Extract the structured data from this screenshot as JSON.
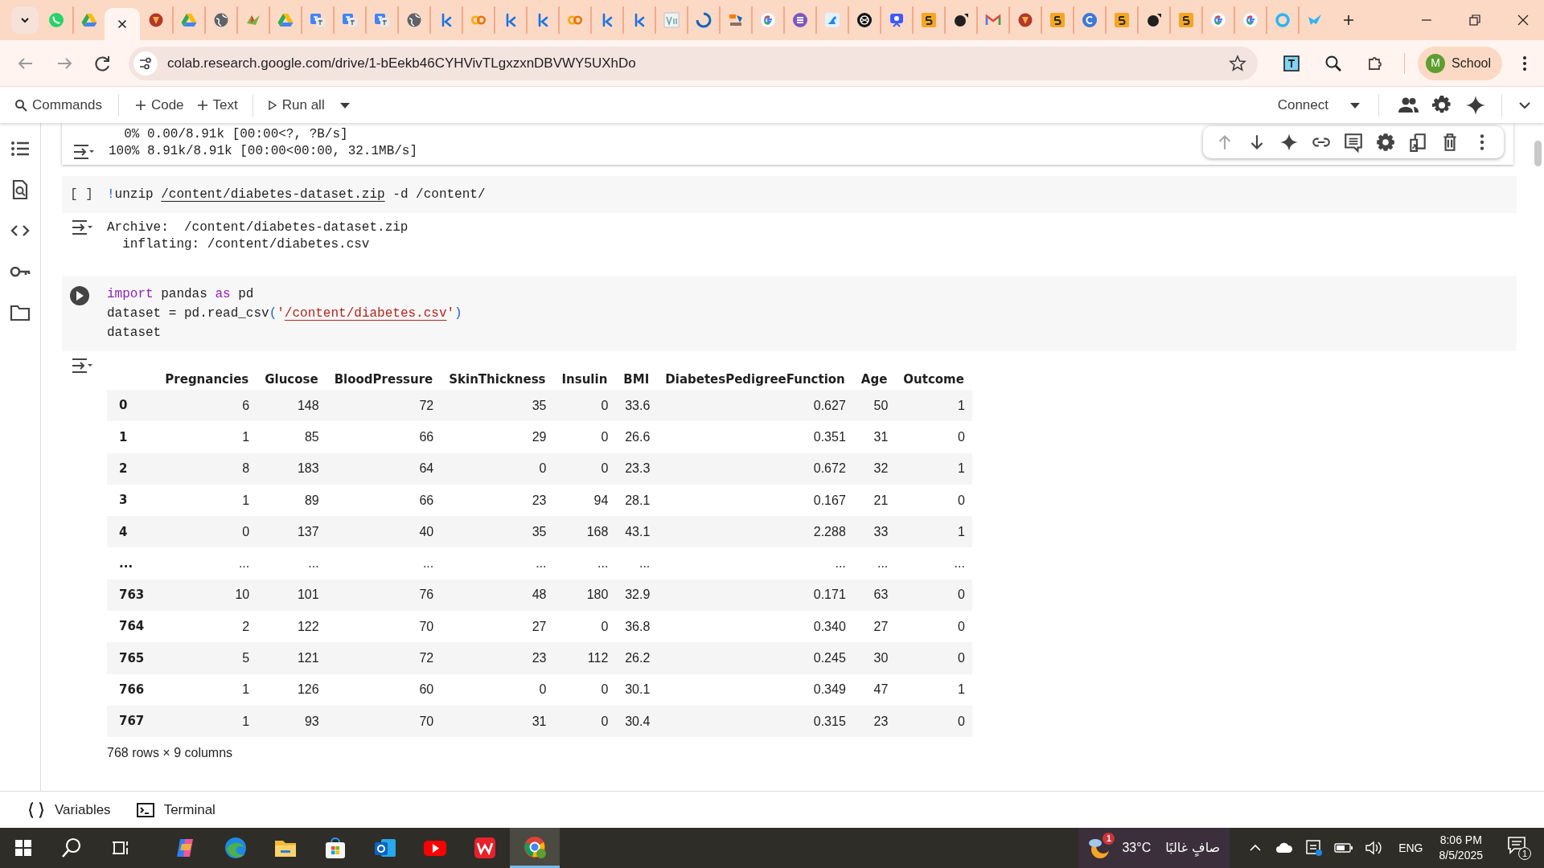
{
  "browser": {
    "tabs": [
      {
        "kind": "whatsapp",
        "selected": false
      },
      {
        "kind": "drive",
        "selected": false
      },
      {
        "kind": "colab",
        "selected": true
      },
      {
        "kind": "shield",
        "selected": false
      },
      {
        "kind": "drive",
        "selected": false
      },
      {
        "kind": "globe",
        "selected": false
      },
      {
        "kind": "bird",
        "selected": false
      },
      {
        "kind": "drive",
        "selected": false
      },
      {
        "kind": "translate",
        "selected": false
      },
      {
        "kind": "translate",
        "selected": false
      },
      {
        "kind": "translate",
        "selected": false
      },
      {
        "kind": "globe",
        "selected": false
      },
      {
        "kind": "k",
        "selected": false
      },
      {
        "kind": "co",
        "selected": false
      },
      {
        "kind": "k",
        "selected": false
      },
      {
        "kind": "k",
        "selected": false
      },
      {
        "kind": "co",
        "selected": false
      },
      {
        "kind": "k",
        "selected": false
      },
      {
        "kind": "k",
        "selected": false
      },
      {
        "kind": "viz",
        "selected": false
      },
      {
        "kind": "spinner",
        "selected": false
      },
      {
        "kind": "figure",
        "selected": false
      },
      {
        "kind": "google",
        "selected": false
      },
      {
        "kind": "layers",
        "selected": false
      },
      {
        "kind": "kangaroo",
        "selected": false
      },
      {
        "kind": "knot",
        "selected": false
      },
      {
        "kind": "present",
        "selected": false
      },
      {
        "kind": "five",
        "selected": false
      },
      {
        "kind": "dot",
        "selected": false
      },
      {
        "kind": "gmail",
        "selected": false
      },
      {
        "kind": "shield",
        "selected": false
      },
      {
        "kind": "five",
        "selected": false
      },
      {
        "kind": "canva",
        "selected": false
      },
      {
        "kind": "five",
        "selected": false
      },
      {
        "kind": "dot",
        "selected": false
      },
      {
        "kind": "five",
        "selected": false
      },
      {
        "kind": "google",
        "selected": false
      },
      {
        "kind": "google",
        "selected": false
      },
      {
        "kind": "ring",
        "selected": false
      },
      {
        "kind": "bird2",
        "selected": false
      }
    ],
    "url": "colab.research.google.com/drive/1-bEekb46CYHVivTLgxzxnDBVWY5UXhDo",
    "profile": {
      "initial": "M",
      "label": "School"
    }
  },
  "toolbar": {
    "commands": "Commands",
    "add_code": "Code",
    "add_text": "Text",
    "run_all": "Run all",
    "connect": "Connect"
  },
  "cell_toolbar": [
    {
      "kind": "up",
      "disabled": true
    },
    {
      "kind": "down",
      "disabled": false
    },
    {
      "kind": "sparkle",
      "disabled": false
    },
    {
      "kind": "link",
      "disabled": false
    },
    {
      "kind": "comment",
      "disabled": false
    },
    {
      "kind": "gear",
      "disabled": false
    },
    {
      "kind": "mirror",
      "disabled": false
    },
    {
      "kind": "trash",
      "disabled": false
    },
    {
      "kind": "more",
      "disabled": false
    }
  ],
  "cells": [
    {
      "kind": "output",
      "output": [
        "  0% 0.00/8.91k [00:00<?, ?B/s]",
        "100% 8.91k/8.91k [00:00<00:00, 32.1MB/s]"
      ]
    },
    {
      "kind": "code",
      "prompt": "[ ]",
      "code": [
        [
          {
            "t": "!",
            "kind": "op"
          },
          {
            "t": "unzip ",
            "kind": "plain"
          },
          {
            "t": "/content/diabetes-dataset.zip",
            "kind": "path"
          },
          {
            "t": " -d /content/",
            "kind": "plain"
          }
        ]
      ],
      "output": [
        "Archive:  /content/diabetes-dataset.zip",
        "  inflating: /content/diabetes.csv"
      ]
    },
    {
      "kind": "code",
      "code": [
        [
          {
            "t": "import",
            "kind": "keyword"
          },
          {
            "t": " pandas ",
            "kind": "plain"
          },
          {
            "t": "as",
            "kind": "keyword"
          },
          {
            "t": " pd",
            "kind": "plain"
          }
        ],
        [
          {
            "t": "dataset = pd.read_csv",
            "kind": "plain"
          },
          {
            "t": "(",
            "kind": "op"
          },
          {
            "t": "'",
            "kind": "string"
          },
          {
            "t": "/content/diabetes.csv",
            "kind": "string-path"
          },
          {
            "t": "'",
            "kind": "string"
          },
          {
            "t": ")",
            "kind": "op"
          }
        ],
        [
          {
            "t": "dataset",
            "kind": "plain"
          }
        ]
      ],
      "table": {
        "columns": [
          "Pregnancies",
          "Glucose",
          "BloodPressure",
          "SkinThickness",
          "Insulin",
          "BMI",
          "DiabetesPedigreeFunction",
          "Age",
          "Outcome"
        ],
        "rows": [
          {
            "index": "0",
            "cells": [
              "6",
              "148",
              "72",
              "35",
              "0",
              "33.6",
              "0.627",
              "50",
              "1"
            ]
          },
          {
            "index": "1",
            "cells": [
              "1",
              "85",
              "66",
              "29",
              "0",
              "26.6",
              "0.351",
              "31",
              "0"
            ]
          },
          {
            "index": "2",
            "cells": [
              "8",
              "183",
              "64",
              "0",
              "0",
              "23.3",
              "0.672",
              "32",
              "1"
            ]
          },
          {
            "index": "3",
            "cells": [
              "1",
              "89",
              "66",
              "23",
              "94",
              "28.1",
              "0.167",
              "21",
              "0"
            ]
          },
          {
            "index": "4",
            "cells": [
              "0",
              "137",
              "40",
              "35",
              "168",
              "43.1",
              "2.288",
              "33",
              "1"
            ]
          },
          {
            "index": "...",
            "cells": [
              "...",
              "...",
              "...",
              "...",
              "...",
              "...",
              "...",
              "...",
              "..."
            ]
          },
          {
            "index": "763",
            "cells": [
              "10",
              "101",
              "76",
              "48",
              "180",
              "32.9",
              "0.171",
              "63",
              "0"
            ]
          },
          {
            "index": "764",
            "cells": [
              "2",
              "122",
              "70",
              "27",
              "0",
              "36.8",
              "0.340",
              "27",
              "0"
            ]
          },
          {
            "index": "765",
            "cells": [
              "5",
              "121",
              "72",
              "23",
              "112",
              "26.2",
              "0.245",
              "30",
              "0"
            ]
          },
          {
            "index": "766",
            "cells": [
              "1",
              "126",
              "60",
              "0",
              "0",
              "30.1",
              "0.349",
              "47",
              "1"
            ]
          },
          {
            "index": "767",
            "cells": [
              "1",
              "93",
              "70",
              "31",
              "0",
              "30.4",
              "0.315",
              "23",
              "0"
            ]
          }
        ],
        "footer": "768 rows × 9 columns"
      }
    }
  ],
  "bottom_bar": {
    "variables": "Variables",
    "terminal": "Terminal"
  },
  "taskbar": {
    "apps": [
      {
        "kind": "copilot",
        "selected": false
      },
      {
        "kind": "edge",
        "selected": false
      },
      {
        "kind": "explorer",
        "selected": false
      },
      {
        "kind": "store",
        "selected": false
      },
      {
        "kind": "outlook",
        "selected": false
      },
      {
        "kind": "youtube",
        "selected": false
      },
      {
        "kind": "wps",
        "selected": false
      },
      {
        "kind": "chrome",
        "selected": true
      }
    ],
    "weather": {
      "badge": "1",
      "temperature": "33°C",
      "condition": "صافٍ غالبًا"
    },
    "language": "ENG",
    "time": "8:06 PM",
    "date": "8/5/2025",
    "notifications": "1"
  }
}
